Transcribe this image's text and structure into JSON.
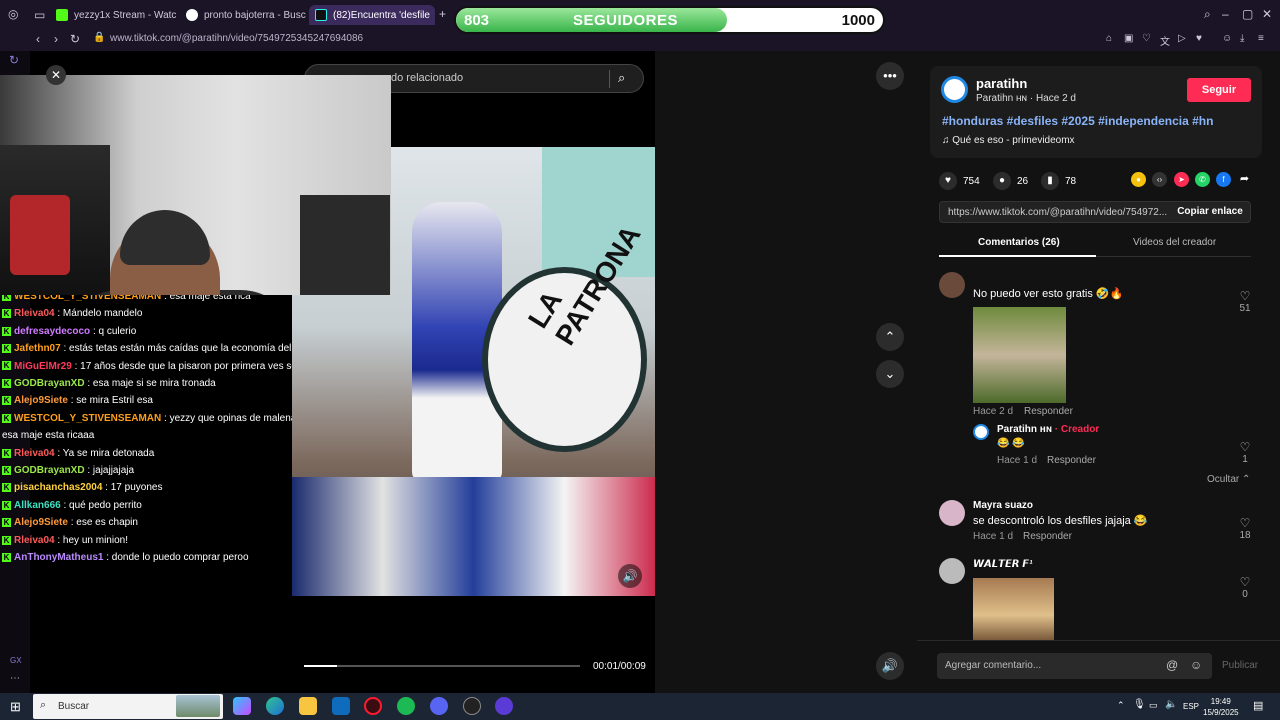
{
  "browser": {
    "tabs": [
      {
        "label": "yezzy1x Stream - Watch Li",
        "favicon_color": "#53fc18"
      },
      {
        "label": "pronto bajoterra - Buscar",
        "favicon_color": "#4285f4"
      },
      {
        "label": "(82)Encuentra 'desfile",
        "favicon_color": "#25f4ee"
      }
    ],
    "url": "www.tiktok.com/@paratihn/video/7549725345247694086"
  },
  "followers_goal": {
    "current": "803",
    "label": "SEGUIDORES",
    "goal": "1000",
    "progress_fraction": 0.803
  },
  "chat": {
    "messages": [
      {
        "user": "WESTCOL_Y_STIVENSEAMAN",
        "color": "#ff9f1a",
        "text": ": esa maje esta rica"
      },
      {
        "user": "Rleiva04",
        "color": "#ff5a5a",
        "text": ": Mándelo mandelo"
      },
      {
        "user": "defresaydecoco",
        "color": "#d07bff",
        "text": ": q culerio"
      },
      {
        "user": "Jafethn07",
        "color": "#ff9f1a",
        "text": ": estás tetas están más caídas que la economía del país"
      },
      {
        "user": "MiGuElMr29",
        "color": "#ff3b5c",
        "text": ": 17 años desde que la pisaron por primera ves sera"
      },
      {
        "user": "GODBrayanXD",
        "color": "#9be74a",
        "text": ": esa maje si se mira tronada"
      },
      {
        "user": "Alejo9Siete",
        "color": "#ff9a3c",
        "text": ": se mira Estril esa"
      },
      {
        "user": "WESTCOL_Y_STIVENSEAMAN",
        "color": "#ff9f1a",
        "text": ": yezzy que opinas de malena maradiaga esa maje esta ricaaa"
      },
      {
        "user": "Rleiva04",
        "color": "#ff5a5a",
        "text": ": Ya se mira detonada"
      },
      {
        "user": "GODBrayanXD",
        "color": "#9be74a",
        "text": ": jajajjajaja"
      },
      {
        "user": "pisachanchas2004",
        "color": "#ffd23f",
        "text": ": 17 puyones"
      },
      {
        "user": "Allkan666",
        "color": "#3de0c0",
        "text": ": qué pedo perrito"
      },
      {
        "user": "Alejo9Siete",
        "color": "#ff9a3c",
        "text": ": ese es chapin"
      },
      {
        "user": "Rleiva04",
        "color": "#ff5a5a",
        "text": ": hey un minion!"
      },
      {
        "user": "AnThonyMatheus1",
        "color": "#b98aff",
        "text": ": donde lo puedo comprar peroo"
      }
    ]
  },
  "video": {
    "search_placeholder": "do relacionado",
    "drum_text": "LA PATRONA",
    "time": "00:01/00:09",
    "progress_fraction": 0.12
  },
  "post": {
    "creator": "paratihn",
    "creator_sub": "Paratihn ʜɴ · Hace 2 d",
    "follow_label": "Seguir",
    "hashtags": "#honduras #desfiles #2025 #independencia #hn",
    "music": "Qué es eso - primevideomx",
    "likes": "754",
    "comments": "26",
    "saves": "78",
    "link": "https://www.tiktok.com/@paratihn/video/754972...",
    "copy_label": "Copiar enlace",
    "tab_comments": "Comentarios (26)",
    "tab_creator_videos": "Videos del creador"
  },
  "comments": [
    {
      "text": "No puedo ver esto gratis 🤣🔥",
      "time": "Hace 2 d",
      "reply": "Responder",
      "likes": "51"
    },
    {
      "author": "Paratihn ʜɴ",
      "creator_tag": "· Creador",
      "text": "😂 😂",
      "time": "Hace 1 d",
      "reply": "Responder",
      "likes": "1",
      "hide": "Ocultar ⌃"
    },
    {
      "author": "Mayra suazo",
      "text": "se descontroló los desfiles jajaja 😂",
      "time": "Hace 1 d",
      "reply": "Responder",
      "likes": "18"
    },
    {
      "author": "𝙒𝘼𝙇𝙏𝙀𝙍 𝙁¹",
      "likes": "0"
    }
  ],
  "comment_input": {
    "placeholder": "Agregar comentario...",
    "publish": "Publicar"
  },
  "taskbar": {
    "search_placeholder": "Buscar",
    "lang": "ESP",
    "time": "19:49",
    "date": "15/9/2025"
  },
  "sidebar": {
    "gx_label": "GX"
  }
}
